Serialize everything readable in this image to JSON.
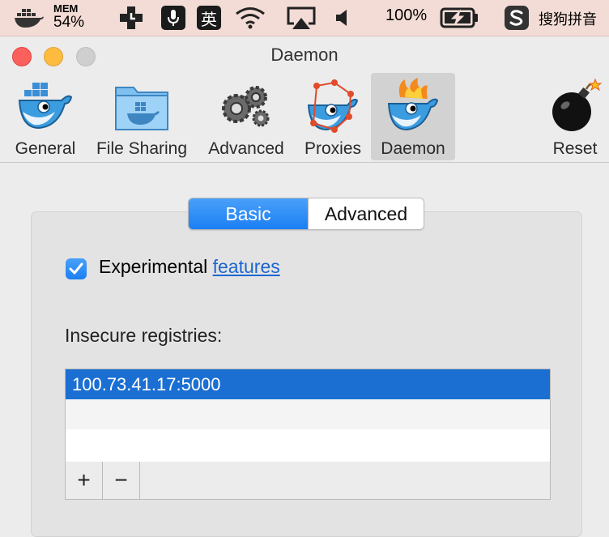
{
  "menubar": {
    "mem_label": "MEM",
    "mem_value": "54%",
    "ime_badge": "英",
    "battery_text": "100%",
    "ime_name": "搜狗拼音",
    "icons": [
      "docker-whale-icon",
      "memory-icon",
      "clock-plus-icon",
      "microphone-icon",
      "ime-english-icon",
      "wifi-icon",
      "airplay-icon",
      "volume-icon",
      "battery-charging-icon",
      "sogou-icon"
    ]
  },
  "window": {
    "title": "Daemon",
    "colors": {
      "close": "#fc605c",
      "minimize": "#fdbc40",
      "zoom": "#cfcfcf"
    }
  },
  "toolbar": {
    "items": [
      {
        "label": "General",
        "icon": "docker-whale-icon"
      },
      {
        "label": "File Sharing",
        "icon": "folder-whale-icon"
      },
      {
        "label": "Advanced",
        "icon": "gears-icon"
      },
      {
        "label": "Proxies",
        "icon": "whale-network-icon"
      },
      {
        "label": "Daemon",
        "icon": "whale-fire-icon",
        "selected": true
      },
      {
        "label": "Reset",
        "icon": "bomb-icon"
      }
    ]
  },
  "tabs": {
    "basic": "Basic",
    "advanced": "Advanced",
    "active": "Basic",
    "accent": "#1b7ff3"
  },
  "experimental": {
    "checked": true,
    "label": "Experimental",
    "link": "features"
  },
  "registries": {
    "label": "Insecure registries:",
    "items": [
      "100.73.41.17:5000"
    ],
    "add_label": "+",
    "remove_label": "−",
    "selection_color": "#1b6fd3"
  }
}
